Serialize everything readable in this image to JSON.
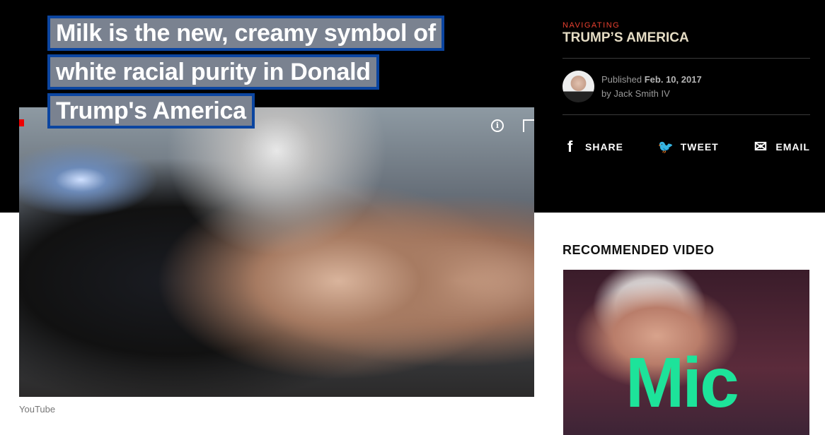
{
  "article": {
    "title_lines": [
      "Milk is the new, creamy symbol of",
      "white racial purity in Donald",
      "Trump's America"
    ],
    "image_caption": "YouTube"
  },
  "video": {
    "info_icon": "i"
  },
  "sidebar": {
    "kicker": "NAVIGATING",
    "series_title": "TRUMP’S AMERICA",
    "published_label": "Published",
    "published_date": "Feb. 10, 2017",
    "byline": "by Jack Smith IV",
    "share": [
      {
        "icon": "facebook-icon",
        "glyph": "f",
        "label": "SHARE"
      },
      {
        "icon": "twitter-icon",
        "glyph": "🐦",
        "label": "TWEET"
      },
      {
        "icon": "email-icon",
        "glyph": "✉",
        "label": "EMAIL"
      }
    ],
    "recommended_heading": "RECOMMENDED VIDEO",
    "recommended_logo": "Mic"
  },
  "colors": {
    "kicker": "#e8402f",
    "series": "#e5dcc4",
    "selection": "#7a8290",
    "selection_border": "#0b45a0",
    "logo": "#1de39a"
  }
}
